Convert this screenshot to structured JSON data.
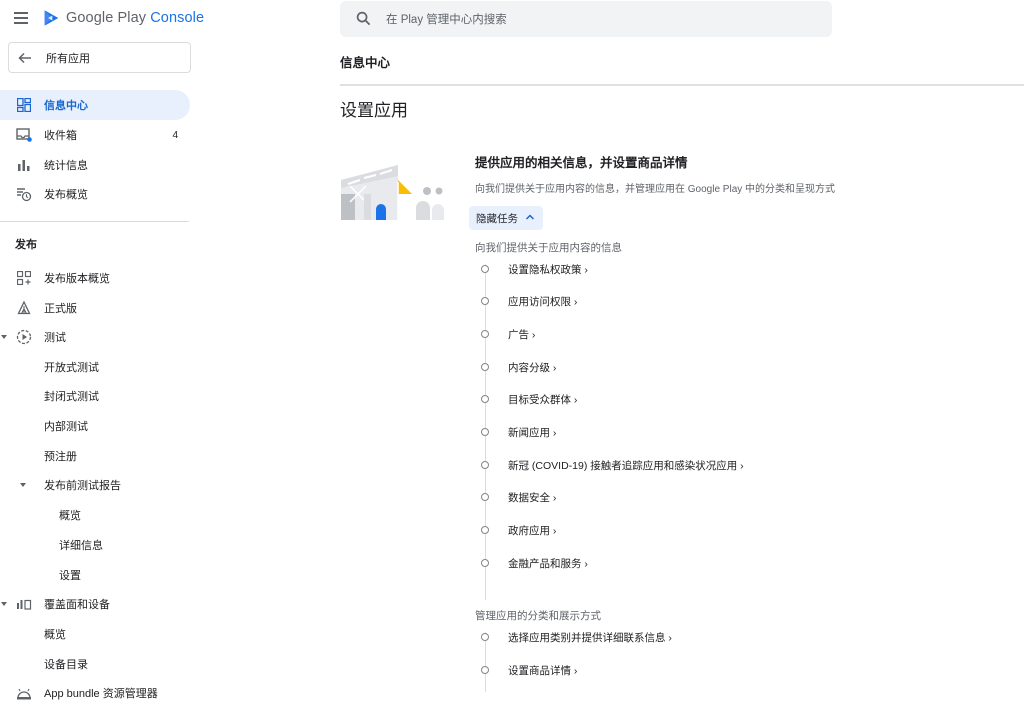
{
  "app": {
    "brand_google_play": "Google Play",
    "brand_console": "Console"
  },
  "sidebar": {
    "all_apps_label": "所有应用",
    "top_items": [
      {
        "label": "信息中心",
        "icon": "dashboard-icon",
        "active": true
      },
      {
        "label": "收件箱",
        "icon": "inbox-icon",
        "count": "4"
      },
      {
        "label": "统计信息",
        "icon": "bar-chart-icon"
      },
      {
        "label": "发布概览",
        "icon": "publishing-overview-icon"
      }
    ],
    "release_section": {
      "title": "发布",
      "items": [
        {
          "label": "发布版本概览",
          "icon": "releases-overview-icon"
        },
        {
          "label": "正式版",
          "icon": "production-icon"
        },
        {
          "label": "测试",
          "icon": "testing-icon"
        },
        {
          "label": "开放式测试"
        },
        {
          "label": "封闭式测试"
        },
        {
          "label": "内部测试"
        },
        {
          "label": "预注册"
        },
        {
          "label": "发布前测试报告"
        },
        {
          "label": "概览"
        },
        {
          "label": "详细信息"
        },
        {
          "label": "设置"
        },
        {
          "label": "覆盖面和设备",
          "icon": "reach-devices-icon"
        },
        {
          "label": "概览"
        },
        {
          "label": "设备目录"
        },
        {
          "label": "App bundle 资源管理器",
          "icon": "app-bundle-icon"
        }
      ]
    }
  },
  "search": {
    "placeholder": "在 Play 管理中心内搜索"
  },
  "breadcrumb": "信息中心",
  "page_title": "设置应用",
  "setup_card": {
    "title": "提供应用的相关信息，并设置商品详情",
    "description": "向我们提供关于应用内容的信息，并管理应用在 Google Play 中的分类和呈现方式",
    "hide_tasks_label": "隐藏任务",
    "groups": [
      {
        "label": "向我们提供关于应用内容的信息",
        "tasks": [
          "设置隐私权政策 ›",
          "应用访问权限 ›",
          "广告 ›",
          "内容分级 ›",
          "目标受众群体 ›",
          "新闻应用 ›",
          "新冠 (COVID-19) 接触者追踪应用和感染状况应用 ›",
          "数据安全 ›",
          "政府应用 ›",
          "金融产品和服务 ›"
        ]
      },
      {
        "label": "管理应用的分类和展示方式",
        "tasks": [
          "选择应用类别并提供详细联系信息 ›",
          "设置商品详情 ›"
        ]
      }
    ]
  },
  "colors": {
    "accent_blue": "#1a73e8",
    "active_bg": "#e8f0fe",
    "brand_yellow": "#fbbc04"
  }
}
